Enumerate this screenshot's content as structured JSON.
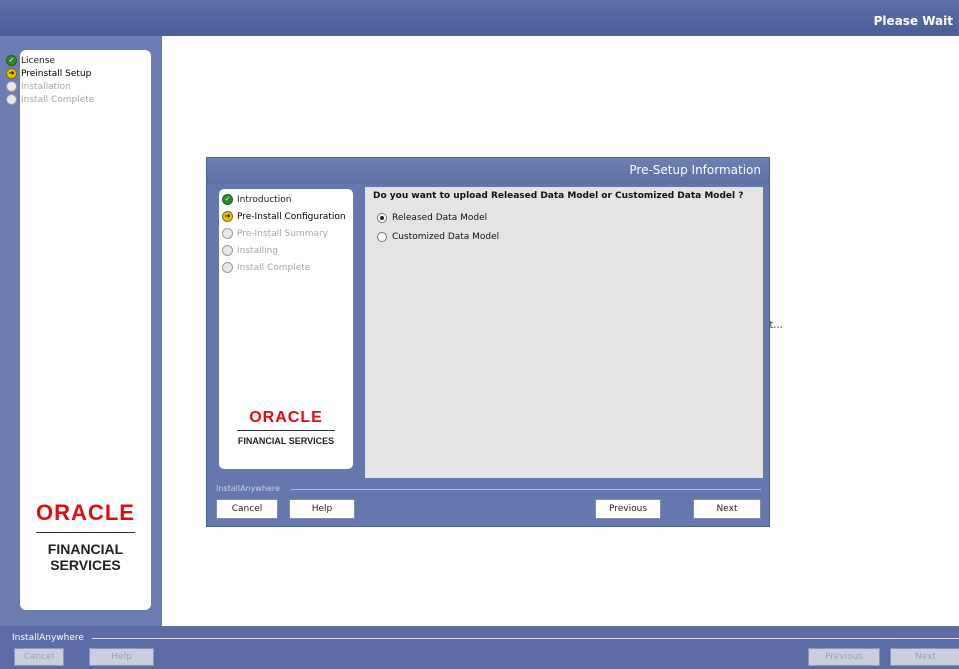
{
  "outer": {
    "title": "Please Wait",
    "steps": [
      {
        "label": "License",
        "state": "done"
      },
      {
        "label": "Preinstall Setup",
        "state": "current"
      },
      {
        "label": "Installation",
        "state": "pending"
      },
      {
        "label": "Install Complete",
        "state": "pending"
      }
    ],
    "logo": {
      "brand": "ORACLE",
      "sub": "FINANCIAL SERVICES"
    },
    "background_fragment": "nt...",
    "brand_label": "InstallAnywhere",
    "buttons": {
      "cancel": "Cancel",
      "help": "Help",
      "previous": "Previous",
      "next": "Next"
    }
  },
  "dialog": {
    "title": "Pre-Setup Information",
    "steps": [
      {
        "label": "Introduction",
        "state": "done"
      },
      {
        "label": "Pre-Install Configuration",
        "state": "current"
      },
      {
        "label": "Pre-Install Summary",
        "state": "pending"
      },
      {
        "label": "Installing",
        "state": "pending"
      },
      {
        "label": "Install Complete",
        "state": "pending"
      }
    ],
    "logo": {
      "brand": "ORACLE",
      "sub": "FINANCIAL SERVICES"
    },
    "question": "Do you want to upload Released Data Model or Customized Data Model ?",
    "options": [
      {
        "label": "Released Data Model",
        "selected": true
      },
      {
        "label": "Customized Data Model",
        "selected": false
      }
    ],
    "brand_label": "InstallAnywhere",
    "buttons": {
      "cancel": "Cancel",
      "help": "Help",
      "previous": "Previous",
      "next": "Next"
    }
  },
  "colors": {
    "chrome": "#5f72a6",
    "oracle_red": "#e10d0d",
    "content_bg": "#e4e4e4"
  }
}
